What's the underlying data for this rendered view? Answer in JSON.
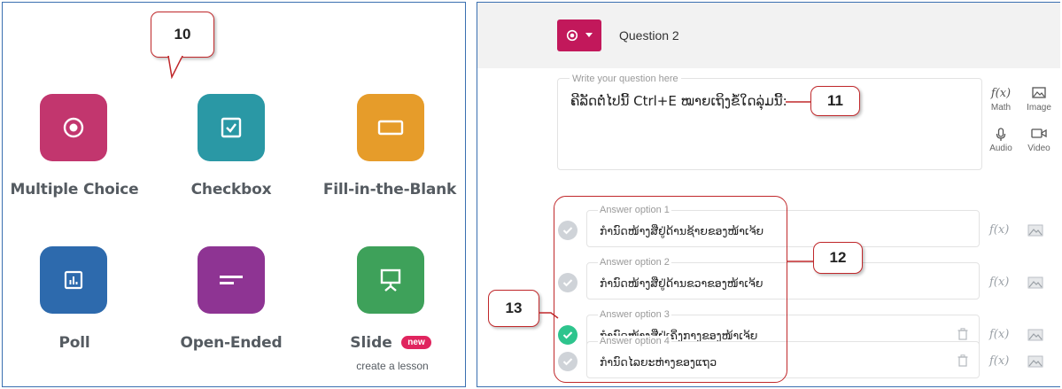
{
  "left": {
    "callout": "10",
    "tiles": [
      {
        "label": "Multiple Choice",
        "color": "#c2366e",
        "icon": "radio-target-icon"
      },
      {
        "label": "Checkbox",
        "color": "#2a98a5",
        "icon": "checkbox-icon"
      },
      {
        "label": "Fill-in-the-Blank",
        "color": "#e69c2a",
        "icon": "blank-box-icon"
      },
      {
        "label": "Poll",
        "color": "#2d6aad",
        "icon": "bar-chart-icon"
      },
      {
        "label": "Open-Ended",
        "color": "#8e3493",
        "icon": "text-lines-icon"
      },
      {
        "label": "Slide",
        "color": "#3ea15a",
        "icon": "presentation-icon"
      }
    ],
    "slide_badge": "new",
    "slide_sub": "create a lesson"
  },
  "right": {
    "question_title": "Question 2",
    "question_placeholder": "Write your question here",
    "question_text": "ຄີລັດຕໍ່ໄປນີ້ Ctrl+E ໝາຍເຖິງຂໍ້ໃດລຸ່ມນີ້:",
    "tools": {
      "math": "Math",
      "image": "Image",
      "audio": "Audio",
      "video": "Video"
    },
    "callouts": {
      "question": "11",
      "answers": "12",
      "correct": "13"
    },
    "answers": [
      {
        "placeholder": "Answer option 1",
        "text": "ກໍານົດໜ້າງສືຢູ່ດ້ານຊ້າຍຂອງໜ້າເຈ້ຍ",
        "correct": false
      },
      {
        "placeholder": "Answer option 2",
        "text": "ກໍານົດໜ້າງສືຢູ່ດ້ານຂວາຂອງໜ້າເຈ້ຍ",
        "correct": false
      },
      {
        "placeholder": "Answer option 3",
        "text": "ກໍານົດໜ້າງສືຢູ່ເຄິ່ງກາງຂອງໜ້າເຈ້ຍ",
        "correct": true
      },
      {
        "placeholder": "Answer option 4",
        "text": "ກໍານົດໄລຍະຫ່າງຂອງແຖວ",
        "correct": false
      }
    ],
    "fx_label": "f(x)"
  }
}
